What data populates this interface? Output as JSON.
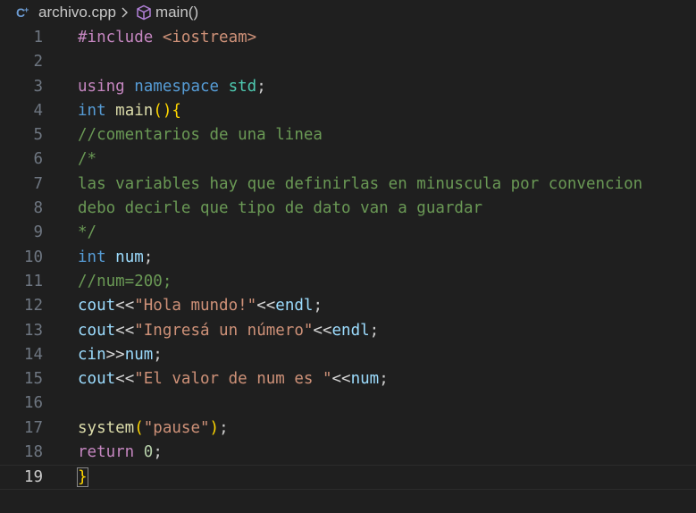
{
  "breadcrumb": {
    "file_icon": "cpp-file-icon",
    "file_name": "archivo.cpp",
    "separator_icon": "chevron-right-icon",
    "symbol_icon": "method-cube-icon",
    "symbol_name": "main()"
  },
  "editor": {
    "current_line": 19,
    "lines": [
      {
        "n": "1",
        "tokens": [
          {
            "c": "t-ctrl",
            "t": "#include "
          },
          {
            "c": "t-inc",
            "t": "<iostream>"
          }
        ]
      },
      {
        "n": "2",
        "tokens": []
      },
      {
        "n": "3",
        "tokens": [
          {
            "c": "t-ctrl",
            "t": "using"
          },
          {
            "c": "t-plain",
            "t": " "
          },
          {
            "c": "t-kw",
            "t": "namespace"
          },
          {
            "c": "t-plain",
            "t": " "
          },
          {
            "c": "t-type",
            "t": "std"
          },
          {
            "c": "t-plain",
            "t": ";"
          }
        ]
      },
      {
        "n": "4",
        "tokens": [
          {
            "c": "t-kw",
            "t": "int"
          },
          {
            "c": "t-plain",
            "t": " "
          },
          {
            "c": "t-fn",
            "t": "main"
          },
          {
            "c": "t-br1",
            "t": "()"
          },
          {
            "c": "t-br1",
            "t": "{"
          }
        ]
      },
      {
        "n": "5",
        "tokens": [
          {
            "c": "t-com",
            "t": "//comentarios de una linea"
          }
        ]
      },
      {
        "n": "6",
        "tokens": [
          {
            "c": "t-com",
            "t": "/*"
          }
        ]
      },
      {
        "n": "7",
        "tokens": [
          {
            "c": "t-com",
            "t": "las variables hay que definirlas en minuscula por convencion"
          }
        ]
      },
      {
        "n": "8",
        "tokens": [
          {
            "c": "t-com",
            "t": "debo decirle que tipo de dato van a guardar"
          }
        ]
      },
      {
        "n": "9",
        "tokens": [
          {
            "c": "t-com",
            "t": "*/"
          }
        ]
      },
      {
        "n": "10",
        "tokens": [
          {
            "c": "t-kw",
            "t": "int"
          },
          {
            "c": "t-plain",
            "t": " "
          },
          {
            "c": "t-var",
            "t": "num"
          },
          {
            "c": "t-plain",
            "t": ";"
          }
        ]
      },
      {
        "n": "11",
        "tokens": [
          {
            "c": "t-com",
            "t": "//num=200;"
          }
        ]
      },
      {
        "n": "12",
        "tokens": [
          {
            "c": "t-var",
            "t": "cout"
          },
          {
            "c": "t-op",
            "t": "<<"
          },
          {
            "c": "t-str",
            "t": "\"Hola mundo!\""
          },
          {
            "c": "t-op",
            "t": "<<"
          },
          {
            "c": "t-var",
            "t": "endl"
          },
          {
            "c": "t-plain",
            "t": ";"
          }
        ]
      },
      {
        "n": "13",
        "tokens": [
          {
            "c": "t-var",
            "t": "cout"
          },
          {
            "c": "t-op",
            "t": "<<"
          },
          {
            "c": "t-str",
            "t": "\"Ingresá un número\""
          },
          {
            "c": "t-op",
            "t": "<<"
          },
          {
            "c": "t-var",
            "t": "endl"
          },
          {
            "c": "t-plain",
            "t": ";"
          }
        ]
      },
      {
        "n": "14",
        "tokens": [
          {
            "c": "t-var",
            "t": "cin"
          },
          {
            "c": "t-op",
            "t": ">>"
          },
          {
            "c": "t-var",
            "t": "num"
          },
          {
            "c": "t-plain",
            "t": ";"
          }
        ]
      },
      {
        "n": "15",
        "tokens": [
          {
            "c": "t-var",
            "t": "cout"
          },
          {
            "c": "t-op",
            "t": "<<"
          },
          {
            "c": "t-str",
            "t": "\"El valor de num es \""
          },
          {
            "c": "t-op",
            "t": "<<"
          },
          {
            "c": "t-var",
            "t": "num"
          },
          {
            "c": "t-plain",
            "t": ";"
          }
        ]
      },
      {
        "n": "16",
        "tokens": []
      },
      {
        "n": "17",
        "tokens": [
          {
            "c": "t-fn",
            "t": "system"
          },
          {
            "c": "t-br1",
            "t": "("
          },
          {
            "c": "t-str",
            "t": "\"pause\""
          },
          {
            "c": "t-br1",
            "t": ")"
          },
          {
            "c": "t-plain",
            "t": ";"
          }
        ]
      },
      {
        "n": "18",
        "tokens": [
          {
            "c": "t-ctrl",
            "t": "return"
          },
          {
            "c": "t-plain",
            "t": " "
          },
          {
            "c": "t-num",
            "t": "0"
          },
          {
            "c": "t-plain",
            "t": ";"
          }
        ]
      },
      {
        "n": "19",
        "tokens": [
          {
            "c": "t-br1 bracket-match",
            "t": "}"
          }
        ]
      }
    ]
  }
}
